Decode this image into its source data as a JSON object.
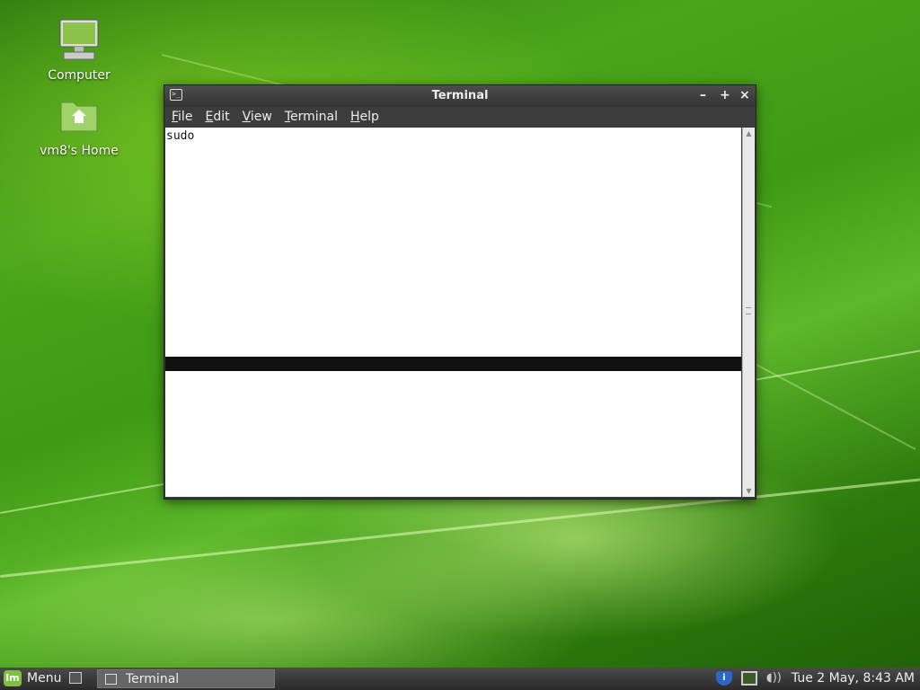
{
  "desktop": {
    "icons": [
      {
        "label": "Computer"
      },
      {
        "label": "vm8's Home"
      }
    ]
  },
  "window": {
    "title": "Terminal",
    "controls": {
      "minimize": "–",
      "maximize": "+",
      "close": "×"
    },
    "menu": [
      "File",
      "Edit",
      "View",
      "Terminal",
      "Help"
    ],
    "terminal_text": "sudo"
  },
  "taskbar": {
    "menu_label": "Menu",
    "mint_logo": "lm",
    "task_label": "Terminal",
    "shield_glyph": "i",
    "volume_glyph": "◖))",
    "clock": "Tue  2 May,  8:43 AM"
  },
  "colors": {
    "mint_accent": "#7dc142",
    "desktop_green": "#4aa51b"
  }
}
